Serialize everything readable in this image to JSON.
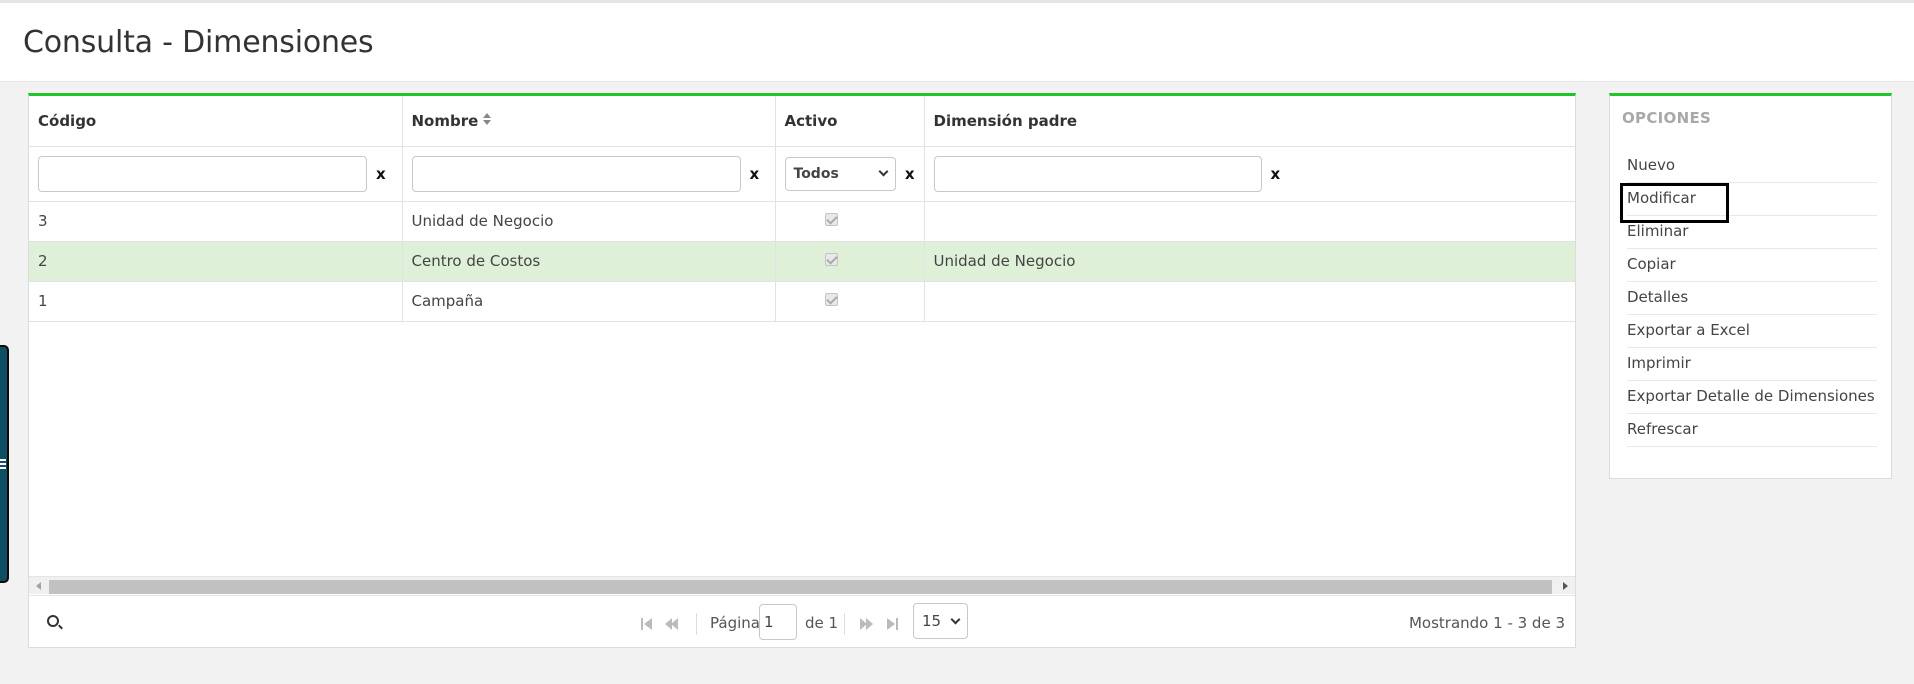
{
  "page": {
    "title": "Consulta - Dimensiones"
  },
  "grid": {
    "columns": [
      {
        "label": "Código",
        "sortable": false
      },
      {
        "label": "Nombre",
        "sortable": true
      },
      {
        "label": "Activo",
        "sortable": false
      },
      {
        "label": "Dimensión padre",
        "sortable": false
      }
    ],
    "filters": {
      "codigo_value": "",
      "nombre_value": "",
      "activo_selected": "Todos",
      "dimension_padre_value": "",
      "clear_label": "x"
    },
    "rows": [
      {
        "codigo": "3",
        "nombre": "Unidad de Negocio",
        "activo": true,
        "dimension_padre": ""
      },
      {
        "codigo": "2",
        "nombre": "Centro de Costos",
        "activo": true,
        "dimension_padre": "Unidad de Negocio",
        "selected": true
      },
      {
        "codigo": "1",
        "nombre": "Campaña",
        "activo": true,
        "dimension_padre": ""
      }
    ]
  },
  "pager": {
    "page_label": "Página",
    "current_page": "1",
    "of_label": "de 1",
    "page_size": "15",
    "summary": "Mostrando 1 - 3 de 3"
  },
  "options": {
    "title": "OPCIONES",
    "items": [
      "Nuevo",
      "Modificar",
      "Eliminar",
      "Copiar",
      "Detalles",
      "Exportar a Excel",
      "Imprimir",
      "Exportar Detalle de Dimensiones",
      "Refrescar"
    ],
    "focused_index": 1
  },
  "colors": {
    "accent": "#22c32b",
    "selected_row": "#dff0d8",
    "side_handle": "#0f4f66"
  },
  "icons": [
    "search-icon",
    "sort-icon",
    "chevron-down-icon",
    "first-page-icon",
    "prev-page-icon",
    "next-page-icon",
    "last-page-icon",
    "grip-icon"
  ]
}
